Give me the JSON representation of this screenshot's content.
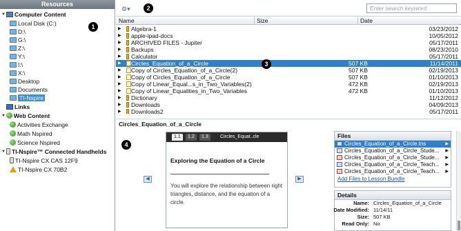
{
  "resources": {
    "title": "Resources",
    "computer_content": "Computer Content",
    "drives": [
      "Local Disk (C:)",
      "D:\\",
      "G:\\",
      "Z:\\",
      "Y:\\",
      "I:\\",
      "X:\\",
      "Desktop",
      "Documents",
      "TI-Nspire"
    ],
    "selected_drive": "TI-Nspire",
    "links": "Links",
    "web_content": "Web Content",
    "web_items": [
      "Activities Exchange",
      "Math Nspired",
      "Science Nspired"
    ],
    "handhelds": "TI-Nspire™ Connected Handhelds",
    "handheld_items": [
      "TI-Nspire CX CAS 12F9",
      "TI-Nspire CX 70B2"
    ]
  },
  "callouts": [
    "1",
    "2",
    "3",
    "4"
  ],
  "toolbar": {
    "gear_icon": "gear-icon",
    "search_placeholder": "Enter search keyword"
  },
  "grid": {
    "col_name": "Name",
    "col_size": "Size",
    "col_date": "Date",
    "rows": [
      {
        "name": "Algebra-1",
        "size": "",
        "date": "03/23/2012",
        "type": "folder"
      },
      {
        "name": "apple-ipad-docs",
        "size": "",
        "date": "10/05/2012",
        "type": "folder"
      },
      {
        "name": "ARCHIVED FILES - Jupiter",
        "size": "",
        "date": "05/17/2011",
        "type": "folder"
      },
      {
        "name": "Backups",
        "size": "",
        "date": "08/23/2010",
        "type": "folder"
      },
      {
        "name": "Calculator",
        "size": "",
        "date": "05/17/2011",
        "type": "folder"
      },
      {
        "name": "Circles_Equation_of_a_Circle",
        "size": "507 KB",
        "date": "11/14/2011",
        "type": "doc",
        "selected": true
      },
      {
        "name": "Copy of Circles_Equation_of_a_Circle(2)",
        "size": "507 KB",
        "date": "02/19/2013",
        "type": "doc"
      },
      {
        "name": "Copy of Circles_Equation_of_a_Circle",
        "size": "507 KB",
        "date": "01/10/2013",
        "type": "doc"
      },
      {
        "name": "Copy of Linear_Equal...s_in_Two_Variables(2)",
        "size": "472 KB",
        "date": "02/19/2013",
        "type": "doc"
      },
      {
        "name": "Copy of Linear_Equalities_in_Two_Variables",
        "size": "472 KB",
        "date": "01/10/2013",
        "type": "doc"
      },
      {
        "name": "Dictionary",
        "size": "",
        "date": "11/12/2012",
        "type": "folder"
      },
      {
        "name": "Downloads",
        "size": "",
        "date": "04/09/2013",
        "type": "folder"
      },
      {
        "name": "Downloads2",
        "size": "",
        "date": "05/17/2011",
        "type": "folder"
      }
    ]
  },
  "preview": {
    "title": "Circles_Equation_of_a_Circle",
    "tabs": [
      "1.1",
      "1.2",
      "1.3"
    ],
    "doc_name": "Circles_Equat..cle",
    "heading": "Exploring the Equation of a Circle",
    "body": "You will explore the relationship between right triangles, distance, and the equation of a circle."
  },
  "files": {
    "title": "Files",
    "items": [
      {
        "name": "Circles_Equation_of_a_Circle.tns",
        "type": "tns",
        "selected": true
      },
      {
        "name": "Circles_Equation_of_a_Circle_Stude...",
        "type": "doc"
      },
      {
        "name": "Circles_Equation_of_a_Circle_Stude...",
        "type": "pdf"
      },
      {
        "name": "Circles_Equation_of_a_Circle_Teach...",
        "type": "doc"
      },
      {
        "name": "Circles_Equation_of_a_Circle_Teach...",
        "type": "pdf"
      }
    ],
    "add_link": "Add Files to Lesson Bundle"
  },
  "details": {
    "title": "Details",
    "rows": [
      {
        "key": "Name:",
        "value": "Circles_Equation_of_a_Circle"
      },
      {
        "key": "Date Modified:",
        "value": "11/14/11"
      },
      {
        "key": "Size:",
        "value": "507 KB"
      },
      {
        "key": "Read Only:",
        "value": "No"
      }
    ]
  }
}
